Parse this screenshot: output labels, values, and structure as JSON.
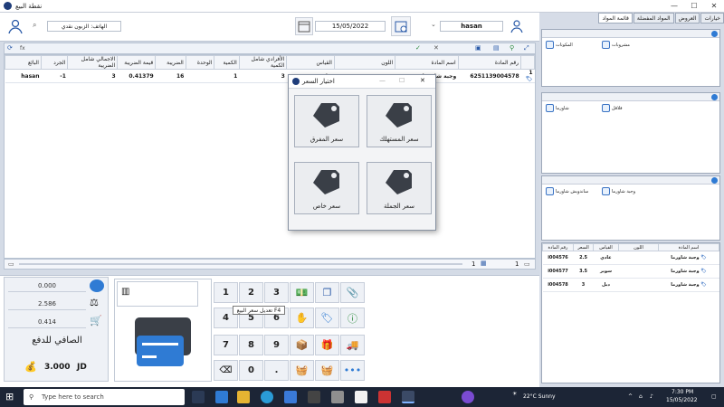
{
  "window": {
    "title": "نقطة البيع"
  },
  "window_controls": {
    "minimize": "—",
    "maximize": "☐",
    "close": "✕"
  },
  "header": {
    "cashier": "hasan",
    "date": "15/05/2022",
    "phone_label": "الهاتف:",
    "customer_name": "الزبون نقدي"
  },
  "grid_toolbar": {
    "row_count": "1",
    "lookup": "fx"
  },
  "grid": {
    "columns": [
      "",
      "رقم المادة",
      "اسم المادة",
      "اللون",
      "القياس",
      "الأفرادي شامل الكمية",
      "الكمية",
      "الوحدة",
      "الضريبة",
      "قيمة الضريبة",
      "الاجمالي شامل الضريبة",
      "الجرد",
      "البائع"
    ],
    "rows": [
      {
        "index": "1",
        "item_no": "6251139004578",
        "name": "وجبة شاورما",
        "color": "",
        "size": "دبل",
        "unit_price": "3",
        "qty": "1",
        "unit": "",
        "tax": "16",
        "tax_value": "0.41379",
        "total": "3",
        "stock": "-1",
        "seller": "hasan"
      }
    ]
  },
  "grid_footer": {
    "count_left": "1",
    "count_mid": "1"
  },
  "price_dialog": {
    "title": "اختيار السعر",
    "options": [
      "سعر المستهلك",
      "سعر المفرق",
      "سعر الجملة",
      "سعر خاص"
    ]
  },
  "summary": {
    "discount": "0.000",
    "subtotal": "2.586",
    "tax": "0.414",
    "net_label": "الصافي للدفع",
    "net_value": "3.000",
    "currency": "JD"
  },
  "keypad": [
    "1",
    "2",
    "3",
    "4",
    "5",
    "6",
    "7",
    "8",
    "9",
    "⌫",
    "0",
    "."
  ],
  "tooltip": "تعديل سعر البيع F4",
  "right_panel": {
    "tabs": [
      "خيارات",
      "العروض",
      "المواد المفضلة",
      "قائمة المواد"
    ],
    "categories_top": [
      "مشروبات",
      "المكونات"
    ],
    "categories_mid": [
      "شاورما",
      "فلافل"
    ],
    "categories_low": [
      "وجبة شاورما",
      "ساندويش شاورما"
    ],
    "items_table": {
      "columns": [
        "اسم المادة",
        "اللون",
        "القياس",
        "السعر",
        "رقم المادة"
      ],
      "rows": [
        {
          "name": "وجبة شاورما",
          "color": "",
          "size": "عادي",
          "price": "2.5",
          "code": "i004576"
        },
        {
          "name": "وجبة شاورما",
          "color": "",
          "size": "سوبر",
          "price": "3.5",
          "code": "i004577"
        },
        {
          "name": "وجبة شاورما",
          "color": "",
          "size": "دبل",
          "price": "3",
          "code": "i004578"
        }
      ]
    }
  },
  "taskbar": {
    "search_placeholder": "Type here to search",
    "weather": "22°C  Sunny",
    "time": "7:30 PM",
    "date": "15/05/2022"
  },
  "colors": {
    "accent": "#2f7bd4",
    "tag_dark": "#3a3f47",
    "taskbar": "#1c2536"
  }
}
